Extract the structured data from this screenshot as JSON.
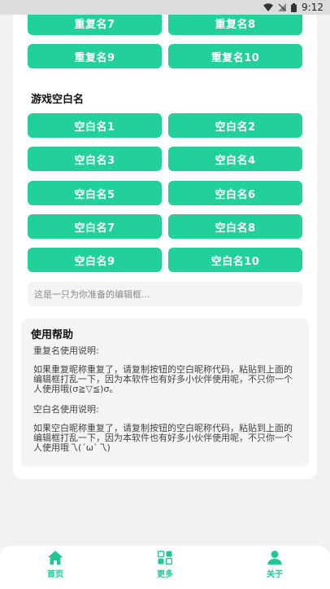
{
  "status_bar": {
    "time": "9:12"
  },
  "repeat_buttons": [
    {
      "label": "重复名7"
    },
    {
      "label": "重复名8"
    },
    {
      "label": "重复名9"
    },
    {
      "label": "重复名10"
    }
  ],
  "blank_section": {
    "title": "游戏空白名",
    "buttons": [
      {
        "label": "空白名1"
      },
      {
        "label": "空白名2"
      },
      {
        "label": "空白名3"
      },
      {
        "label": "空白名4"
      },
      {
        "label": "空白名5"
      },
      {
        "label": "空白名6"
      },
      {
        "label": "空白名7"
      },
      {
        "label": "空白名8"
      },
      {
        "label": "空白名9"
      },
      {
        "label": "空白名10"
      }
    ]
  },
  "edit_box": {
    "placeholder": "这是一只为你准备的编辑框..."
  },
  "help": {
    "title": "使用帮助",
    "repeat_heading": "重复名使用说明:",
    "repeat_body": "如果重复昵称重复了，请复制按钮的空白昵称代码，粘贴到上面的编辑框打乱一下，因为本软件也有好多小伙伴使用呢，不只你一个人使用哦(σ≧▽≦)σ。",
    "blank_heading": "空白名使用说明:",
    "blank_body": "如果空白昵称重复了，请复制按钮的空白昵称代码，粘贴到上面的编辑框打乱一下，因为本软件也有好多小伙伴使用呢，不只你一个人使用哦乁(´ω`乁)"
  },
  "bottom_nav": [
    {
      "label": "首页",
      "icon": "home-icon"
    },
    {
      "label": "更多",
      "icon": "more-icon"
    },
    {
      "label": "关于",
      "icon": "person-icon"
    }
  ],
  "colors": {
    "accent": "#22d19a",
    "background": "#f1f2f1",
    "nav_active": "#1ec896"
  }
}
